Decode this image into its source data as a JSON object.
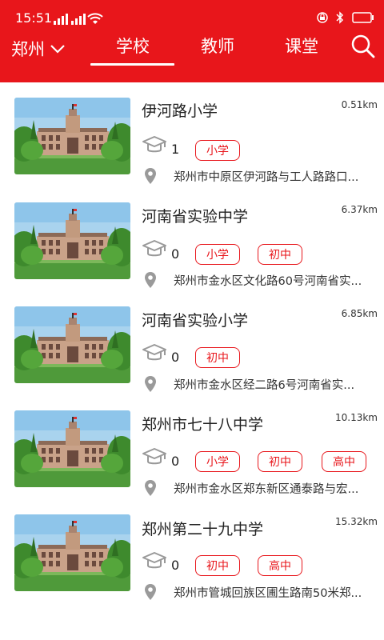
{
  "status_bar": {
    "time": "15:51"
  },
  "nav": {
    "city": "郑州",
    "tabs": [
      {
        "label": "学校",
        "active": true
      },
      {
        "label": "教师",
        "active": false
      },
      {
        "label": "课堂",
        "active": false
      }
    ]
  },
  "colors": {
    "brand_red": "#e8161b"
  },
  "schools": [
    {
      "name": "伊河路小学",
      "distance": "0.51km",
      "count": "1",
      "levels": [
        "小学"
      ],
      "address": "郑州市中原区伊河路与工人路路口..."
    },
    {
      "name": "河南省实验中学",
      "distance": "6.37km",
      "count": "0",
      "levels": [
        "小学",
        "初中"
      ],
      "address": "郑州市金水区文化路60号河南省实..."
    },
    {
      "name": "河南省实验小学",
      "distance": "6.85km",
      "count": "0",
      "levels": [
        "初中"
      ],
      "address": "郑州市金水区经二路6号河南省实..."
    },
    {
      "name": "郑州市七十八中学",
      "distance": "10.13km",
      "count": "0",
      "levels": [
        "小学",
        "初中",
        "高中"
      ],
      "address": "郑州市金水区郑东新区通泰路与宏..."
    },
    {
      "name": "郑州第二十九中学",
      "distance": "15.32km",
      "count": "0",
      "levels": [
        "初中",
        "高中"
      ],
      "address": "郑州市管城回族区圃生路南50米郑..."
    }
  ]
}
